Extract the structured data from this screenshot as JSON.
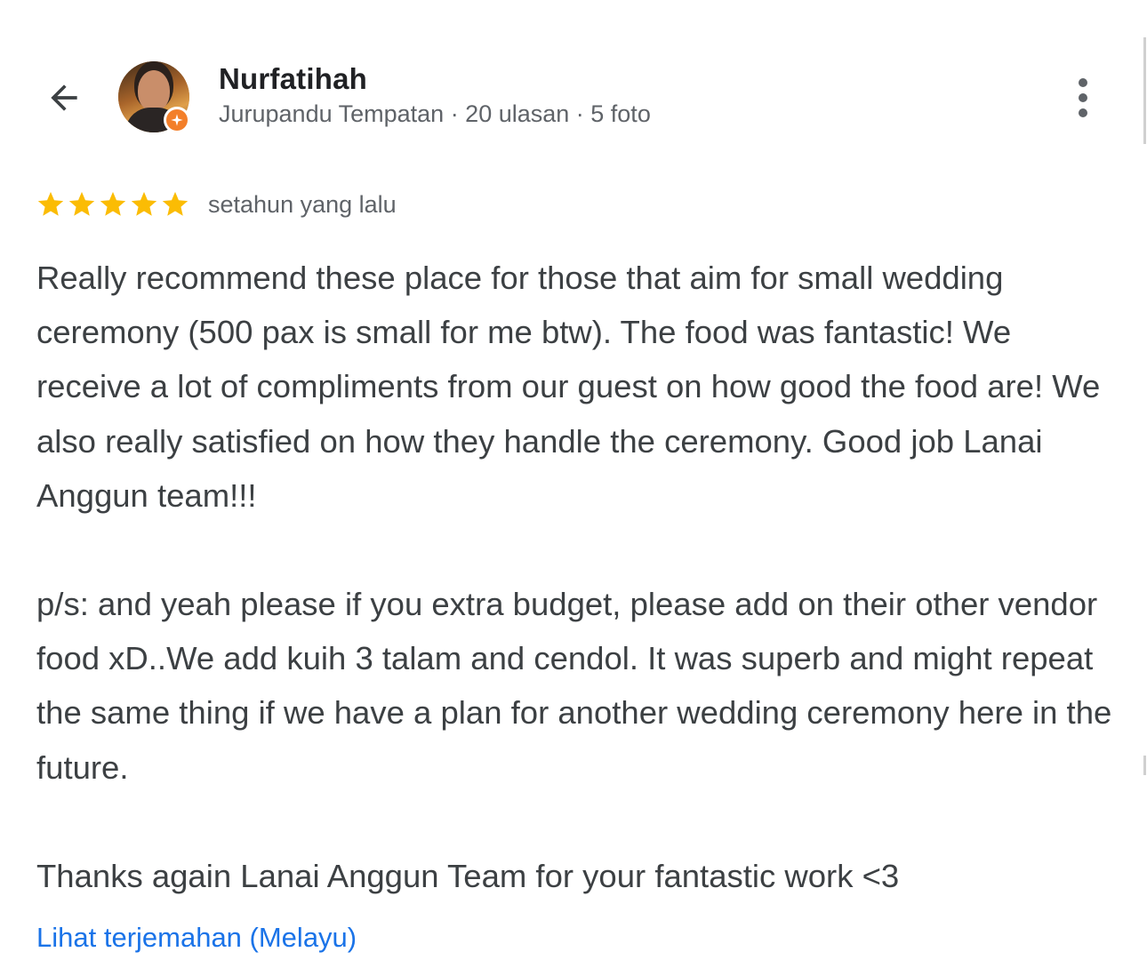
{
  "header": {
    "back_icon": "arrow-left-icon",
    "user": {
      "name": "Nurfatihah",
      "meta": "Jurupandu Tempatan · 20 ulasan · 5 foto",
      "badge_icon": "local-guide-star-icon",
      "badge_color": "#f37f2a"
    },
    "more_icon": "more-vert-icon"
  },
  "review": {
    "rating": 5,
    "rating_max": 5,
    "star_color": "#fbbc04",
    "date": "setahun yang lalu",
    "paragraphs": [
      "Really recommend these place for those that aim for small wedding ceremony (500 pax is small for me btw). The food was fantastic! We receive a lot of compliments from our guest on how good the food are! We also really satisfied on how they handle the ceremony. Good job Lanai Anggun team!!!",
      "p/s: and yeah please if you extra budget, please add on their other vendor food xD..We add kuih 3 talam and cendol. It was superb and might repeat the same thing if we have a plan for another wedding ceremony here in the future.",
      "Thanks again Lanai Anggun Team for your fantastic work <3"
    ],
    "translate_link": "Lihat terjemahan (Melayu)",
    "link_color": "#1a73e8"
  }
}
